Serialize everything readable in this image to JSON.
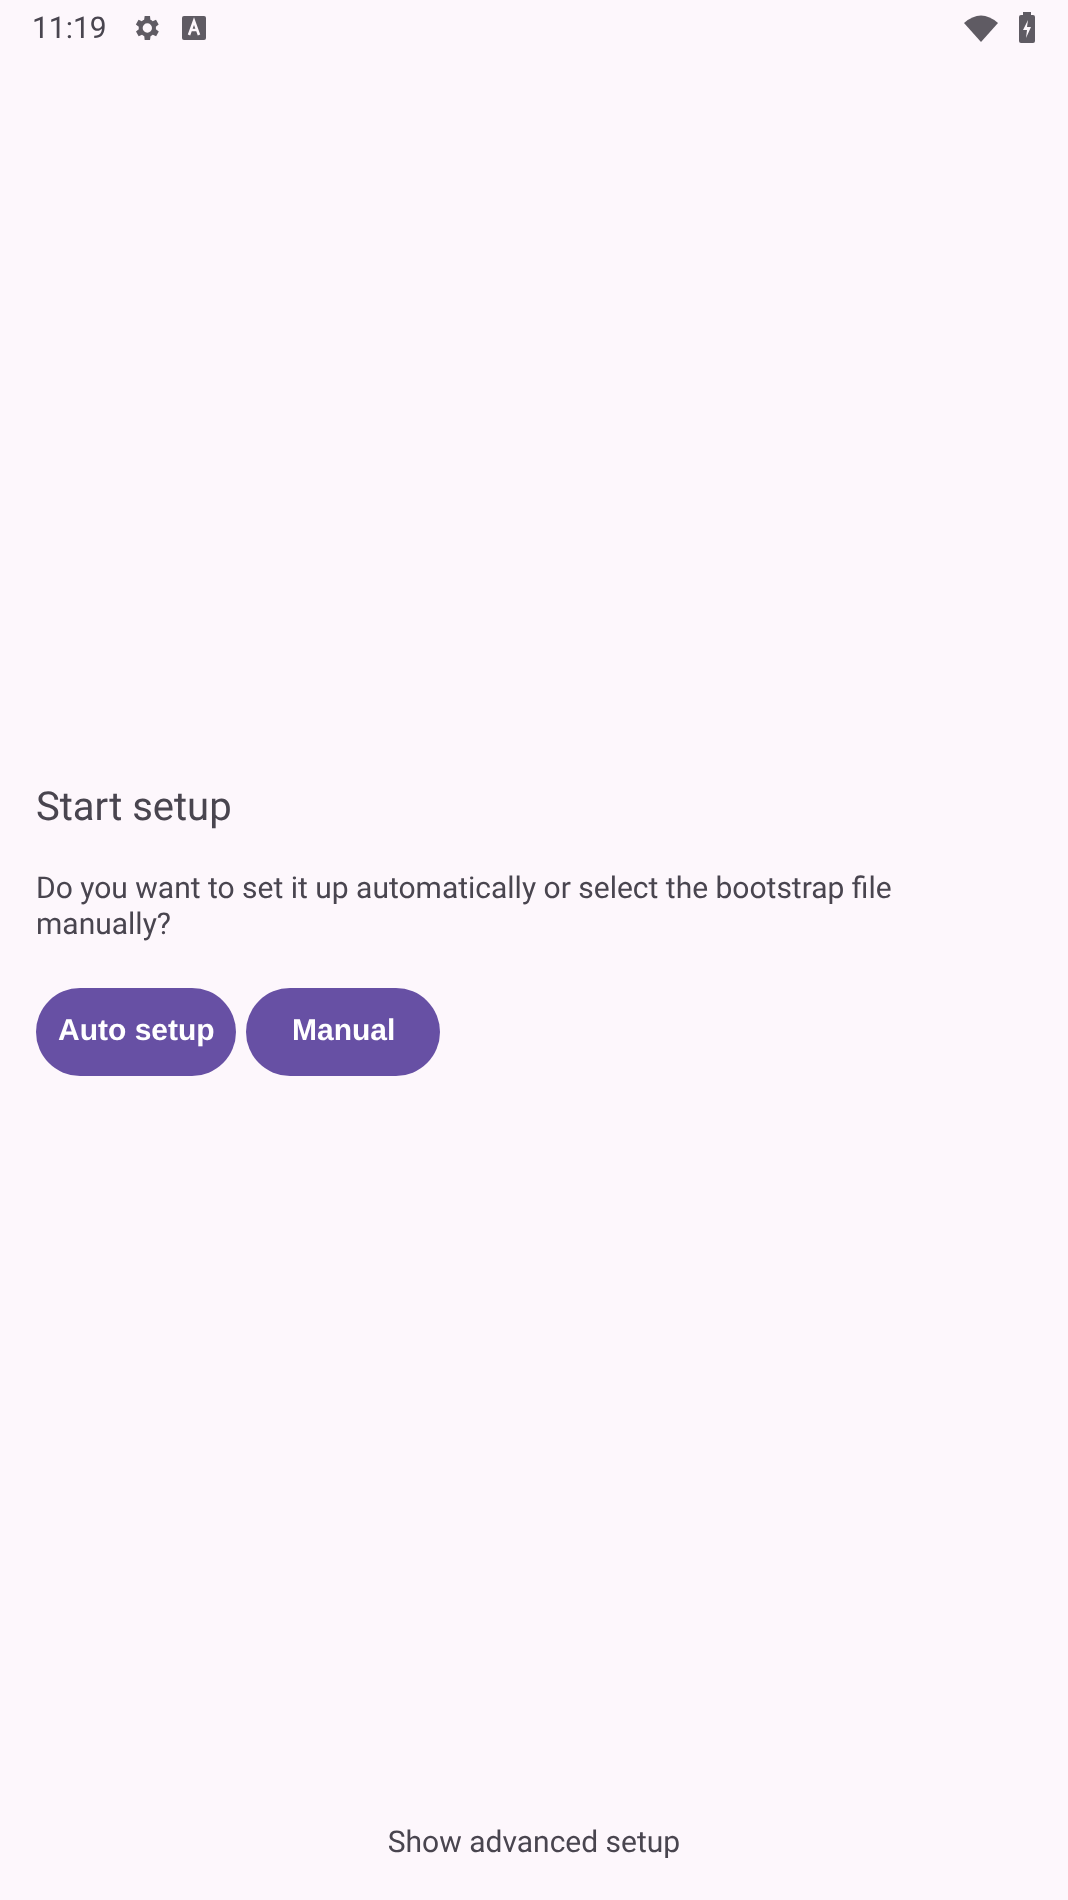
{
  "status_bar": {
    "time": "11:19"
  },
  "setup": {
    "title": "Start setup",
    "message": "Do you want to set it up automatically or select the bootstrap file manually?",
    "buttons": [
      "Auto setup",
      "Manual"
    ]
  },
  "footer": {
    "link": "Show advanced setup"
  }
}
